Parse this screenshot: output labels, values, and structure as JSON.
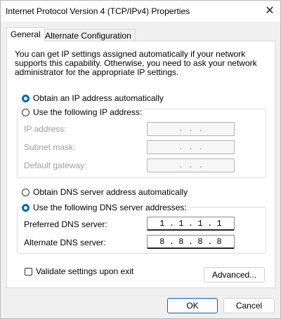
{
  "window": {
    "title": "Internet Protocol Version 4 (TCP/IPv4) Properties",
    "close_glyph": "✕"
  },
  "tabs": [
    {
      "label": "General",
      "active": true
    },
    {
      "label": "Alternate Configuration",
      "active": false
    }
  ],
  "description": "You can get IP settings assigned automatically if your network supports this capability. Otherwise, you need to ask your network administrator for the appropriate IP settings.",
  "ip_settings": {
    "auto_label": "Obtain an IP address automatically",
    "auto_selected": true,
    "manual_label": "Use the following IP address:",
    "manual_selected": false,
    "fields": [
      {
        "label": "IP address:",
        "value": ". . ."
      },
      {
        "label": "Subnet mask:",
        "value": ". . ."
      },
      {
        "label": "Default gateway:",
        "value": ". . ."
      }
    ]
  },
  "dns_settings": {
    "auto_label": "Obtain DNS server address automatically",
    "auto_selected": false,
    "manual_label": "Use the following DNS server addresses:",
    "manual_selected": true,
    "preferred_label": "Preferred DNS server:",
    "preferred_octets": [
      "1",
      "1",
      "1",
      "1"
    ],
    "alternate_label": "Alternate DNS server:",
    "alternate_octets": [
      "8",
      "8",
      "8",
      "8"
    ]
  },
  "validate": {
    "label": "Validate settings upon exit",
    "checked": false
  },
  "buttons": {
    "advanced": "Advanced...",
    "ok": "OK",
    "cancel": "Cancel"
  },
  "colors": {
    "accent": "#0067c0",
    "disabled_text": "#9d9d9d"
  }
}
